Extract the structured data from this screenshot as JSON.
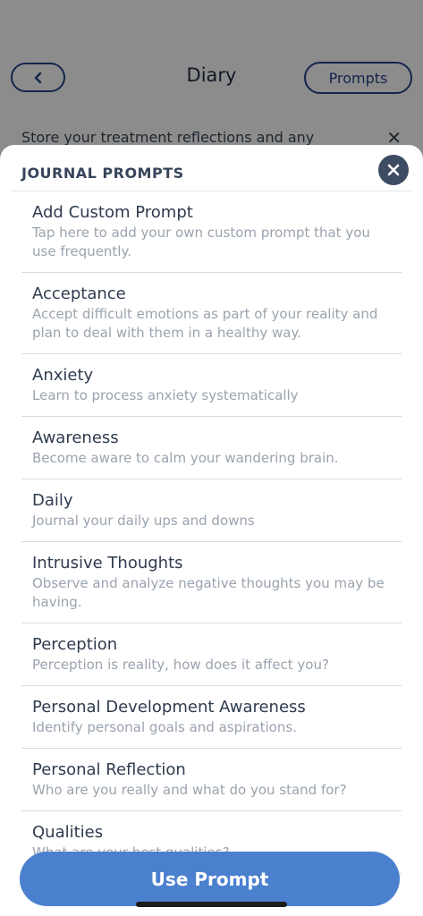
{
  "background": {
    "title": "Diary",
    "prompts_button": "Prompts",
    "note": "Store your treatment reflections and any"
  },
  "sheet": {
    "title": "JOURNAL PROMPTS",
    "prompts": [
      {
        "title": "Add Custom Prompt",
        "description": "Tap here to add your own custom prompt that you use frequently."
      },
      {
        "title": "Acceptance",
        "description": "Accept difficult emotions as part of your reality and plan to deal with them in a healthy way."
      },
      {
        "title": "Anxiety",
        "description": "Learn to process anxiety systematically"
      },
      {
        "title": "Awareness",
        "description": "Become aware to calm your wandering brain."
      },
      {
        "title": "Daily",
        "description": "Journal your daily ups and downs"
      },
      {
        "title": "Intrusive Thoughts",
        "description": "Observe and analyze negative thoughts you may be having."
      },
      {
        "title": "Perception",
        "description": "Perception is reality, how does it affect you?"
      },
      {
        "title": "Personal Development Awareness",
        "description": "Identify personal goals and aspirations."
      },
      {
        "title": "Personal Reflection",
        "description": "Who are you really and what do you stand for?"
      },
      {
        "title": "Qualities",
        "description": "What are your best qualities?"
      }
    ],
    "use_button": "Use Prompt"
  },
  "colors": {
    "accent": "#4b80cf",
    "dark": "#3d4b63",
    "outline": "#26428b"
  }
}
